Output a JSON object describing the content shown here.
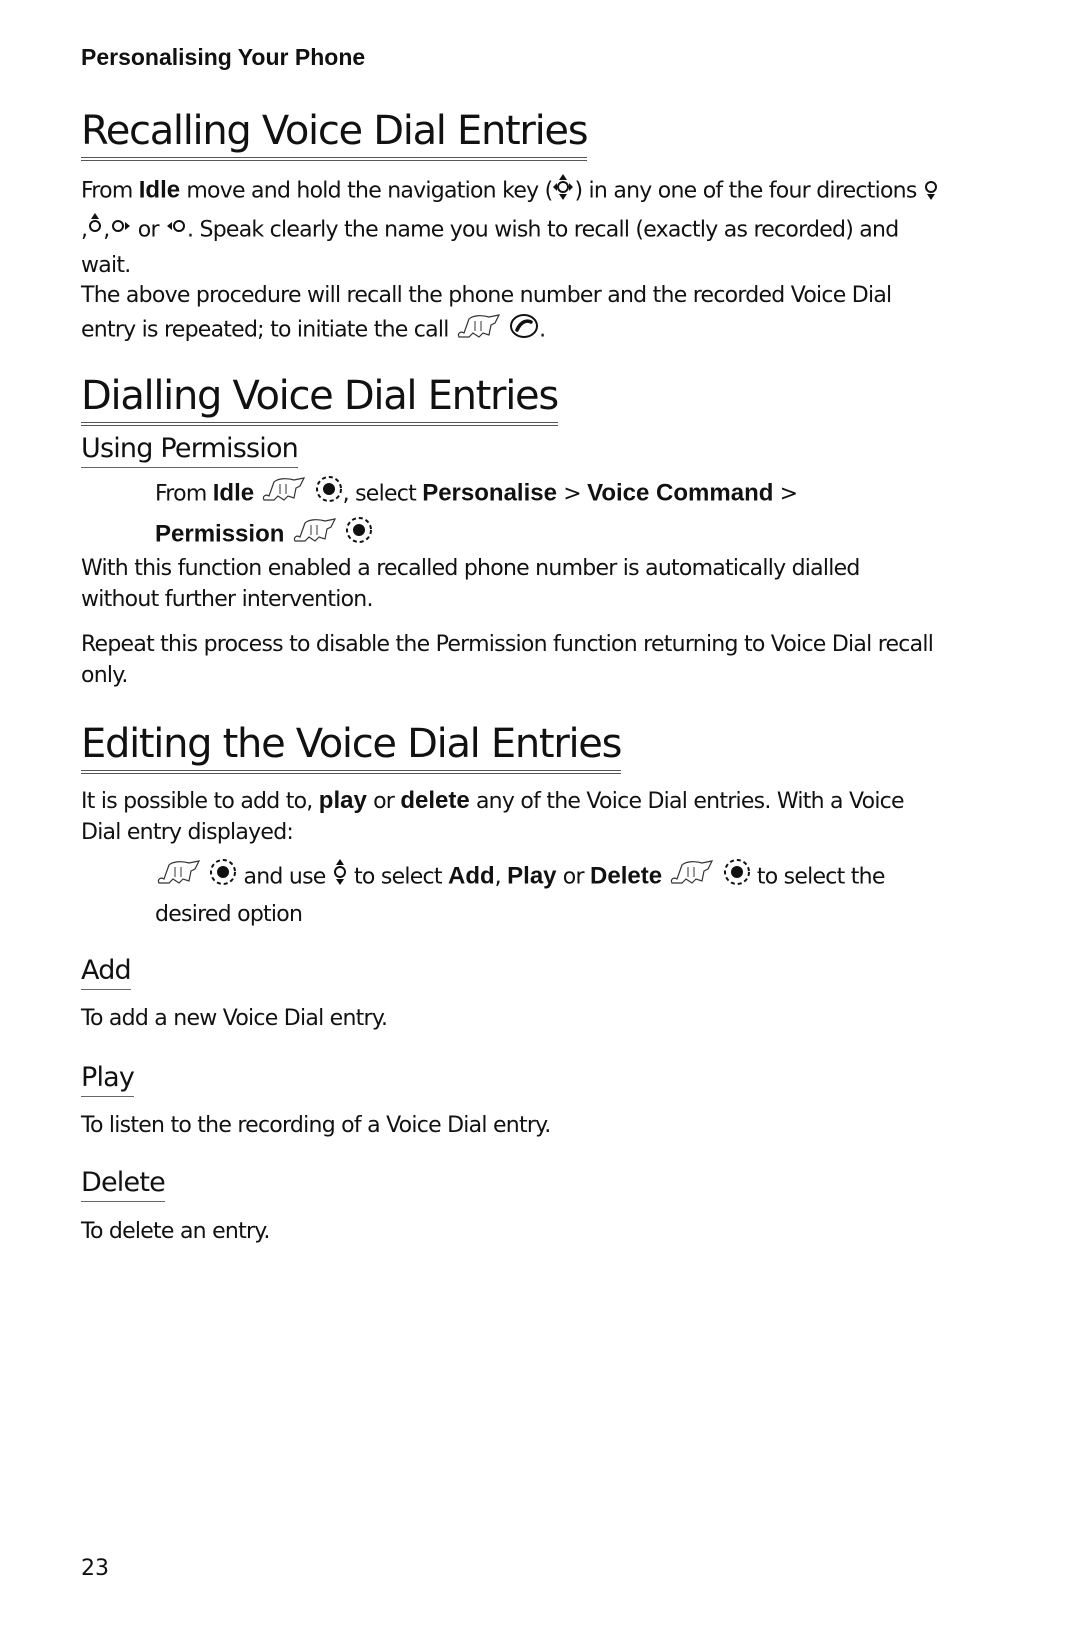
{
  "header": {
    "running_head": "Personalising Your Phone"
  },
  "sections": {
    "recalling": {
      "title": "Recalling Voice Dial Entries",
      "p1": {
        "t1": "From ",
        "idle": "Idle",
        "t2": " move and hold the navigation key (",
        "t3": ") in any one of the four directions ",
        "c1": ",",
        "c2": ",",
        "t4": " or ",
        "t5": ". Speak clearly the name you wish to recall (exactly as recorded) and wait."
      },
      "p2": {
        "t1": "The above procedure will recall the phone number and the recorded Voice Dial entry is repeated; to initiate the call ",
        "t2": "."
      }
    },
    "dialling": {
      "title": "Dialling Voice Dial Entries",
      "subtitle": "Using Permission",
      "instr": {
        "t1": "From ",
        "idle": "Idle",
        "t2": ", select ",
        "personalise": "Personalise",
        "sep1": " > ",
        "voice_command": "Voice Command",
        "sep2": " > ",
        "permission": "Permission"
      },
      "p1": "With this function enabled a recalled phone number is automatically dialled without further intervention.",
      "p2": "Repeat this process to disable the Permission function returning to Voice Dial recall only."
    },
    "editing": {
      "title": "Editing the Voice Dial Entries",
      "p1": {
        "t1": "It is possible to add to, ",
        "play": "play",
        "t2": " or ",
        "delete": "delete",
        "t3": " any of the Voice Dial entries. With a Voice Dial entry displayed:"
      },
      "instr": {
        "t1": " and use ",
        "t2": " to select ",
        "add": "Add",
        "comma": ", ",
        "play": "Play",
        "or": " or ",
        "delete": "Delete",
        "t3": " to select the desired option"
      },
      "options": [
        {
          "title": "Add",
          "desc": "To add a new Voice Dial entry."
        },
        {
          "title": "Play",
          "desc": "To listen to the recording of a Voice Dial entry."
        },
        {
          "title": "Delete",
          "desc": "To delete an entry."
        }
      ]
    }
  },
  "footer": {
    "page_number": "23"
  },
  "icons": {
    "press": "hand-press-icon",
    "select": "select-key-icon",
    "call": "call-key-icon",
    "nav": "navigation-key-icon"
  }
}
